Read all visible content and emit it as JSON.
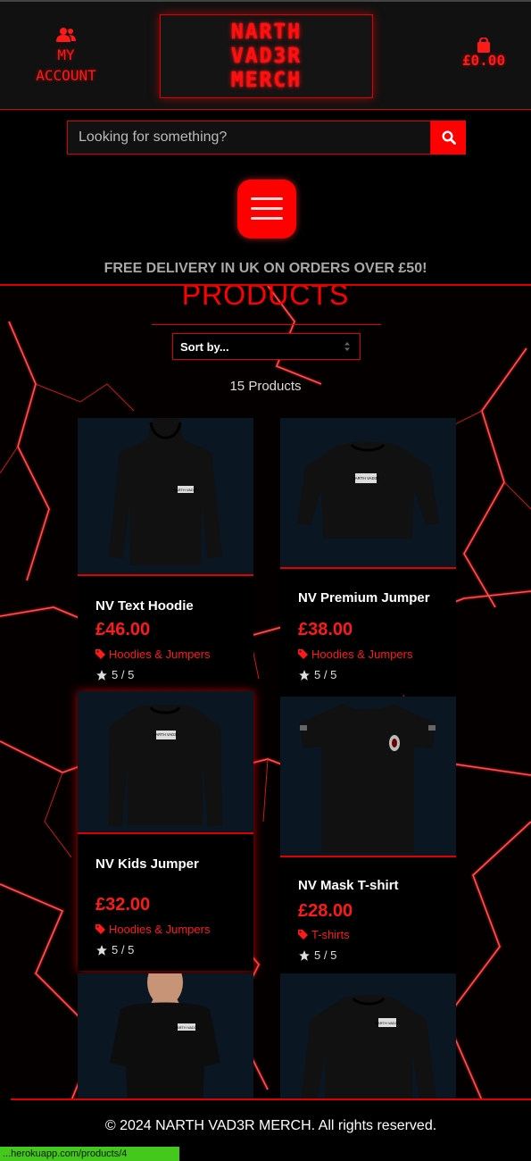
{
  "header": {
    "account_label_1": "MY",
    "account_label_2": "ACCOUNT",
    "logo_line_1": "NARTH",
    "logo_line_2": "VAD3R",
    "logo_line_3": "MERCH",
    "cart_total": "£0.00"
  },
  "search": {
    "placeholder": "Looking for something?"
  },
  "banner": "FREE DELIVERY IN UK ON ORDERS OVER £50!",
  "products": {
    "title": "PRODUCTS",
    "sort_label": "Sort by...",
    "count": "15 Products",
    "items": [
      {
        "name": "NV Text Hoodie",
        "price": "£46.00",
        "category": "Hoodies & Jumpers",
        "rating": "5 / 5"
      },
      {
        "name": "NV Premium Jumper",
        "price": "£38.00",
        "category": "Hoodies & Jumpers",
        "rating": "5 / 5"
      },
      {
        "name": "NV Kids Jumper",
        "price": "£32.00",
        "category": "Hoodies & Jumpers",
        "rating": "5 / 5"
      },
      {
        "name": "NV Mask T-shirt",
        "price": "£28.00",
        "category": "T-shirts",
        "rating": "5 / 5"
      },
      {
        "name": "",
        "price": "",
        "category": "",
        "rating": ""
      },
      {
        "name": "",
        "price": "",
        "category": "",
        "rating": ""
      }
    ]
  },
  "product_thumb_text": "NARTH VAD3R",
  "footer": "© 2024 NARTH VAD3R MERCH. All rights reserved.",
  "status_url": "...herokuapp.com/products/4",
  "colors": {
    "accent": "#ff0000",
    "background": "#000000",
    "header_bg": "#111111",
    "image_bg": "#0a1622",
    "status_bar": "#43c81b"
  }
}
